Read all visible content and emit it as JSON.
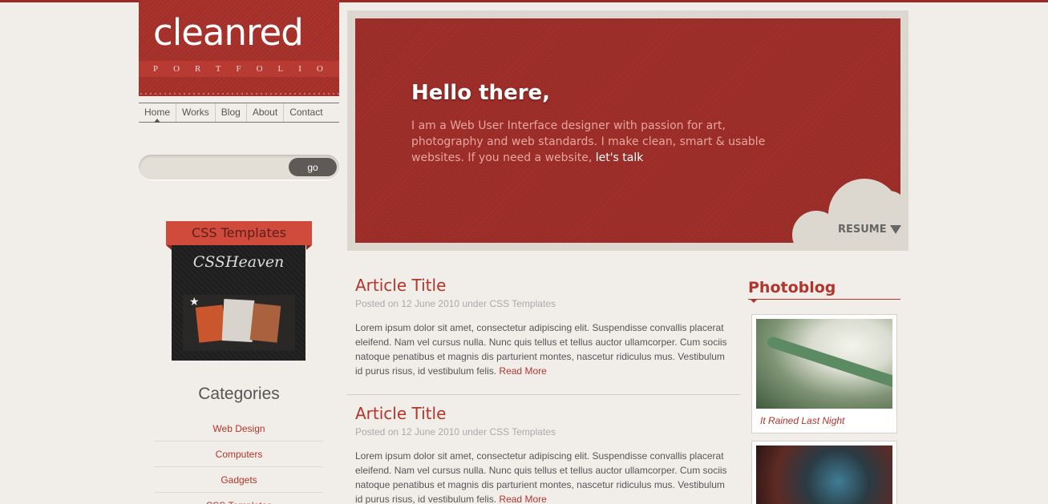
{
  "logo": {
    "title": "cleanred",
    "subtitle": "PORTFOLIO"
  },
  "nav": {
    "items": [
      "Home",
      "Works",
      "Blog",
      "About",
      "Contact"
    ]
  },
  "search": {
    "button_label": "go",
    "placeholder": ""
  },
  "ad": {
    "ribbon": "CSS Templates",
    "logo_text": "CSSHeaven"
  },
  "categories": {
    "heading": "Categories",
    "items": [
      "Web Design",
      "Computers",
      "Gadgets",
      "CSS Templates"
    ]
  },
  "hero": {
    "title": "Hello there,",
    "text": "I am a Web User Interface designer with passion for art, photography and web standards. I make clean, smart & usable websites. If you need a website,",
    "link": "let's talk",
    "resume": "RESUME"
  },
  "articles": [
    {
      "title": "Article Title",
      "meta": "Posted on 12 June 2010 under CSS Templates",
      "body": "Lorem ipsum dolor sit amet, consectetur adipiscing elit. Suspendisse convallis placerat eleifend. Nam vel cursus nulla. Nunc quis tellus et tellus auctor ullamcorper. Cum sociis natoque penatibus et magnis dis parturient montes, nascetur ridiculus mus. Vestibulum id purus risus, id vestibulum felis.",
      "read_more": "Read More"
    },
    {
      "title": "Article Title",
      "meta": "Posted on 12 June 2010 under CSS Templates",
      "body": "Lorem ipsum dolor sit amet, consectetur adipiscing elit. Suspendisse convallis placerat eleifend. Nam vel cursus nulla. Nunc quis tellus et tellus auctor ullamcorper. Cum sociis natoque penatibus et magnis dis parturient montes, nascetur ridiculus mus. Vestibulum id purus risus, id vestibulum felis.",
      "read_more": "Read More"
    }
  ],
  "photoblog": {
    "heading": "Photoblog",
    "items": [
      {
        "caption": "It Rained Last Night"
      }
    ]
  },
  "colors": {
    "accent": "#b3342b",
    "brand_red": "#a22f2a",
    "background": "#f1eeea"
  }
}
